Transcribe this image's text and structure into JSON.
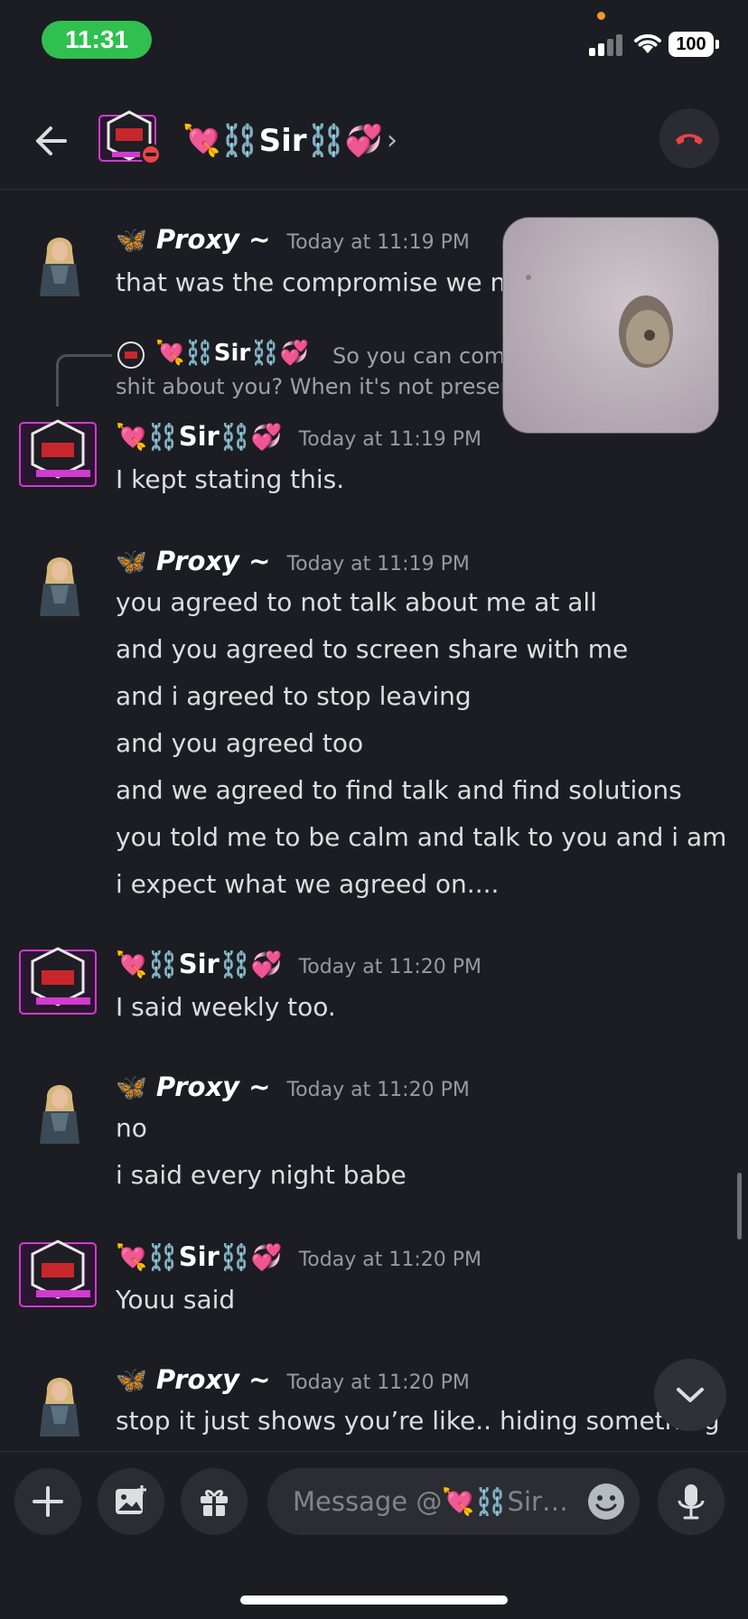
{
  "status_bar": {
    "time": "11:31",
    "battery": "100"
  },
  "header": {
    "title": "💘⛓️Sir⛓️💞",
    "chevron": "›"
  },
  "messages": [
    {
      "author": "Proxy ~",
      "badge": "🦋",
      "time": "Today at 11:19 PM",
      "lines": [
        "that was the compromise we ma"
      ]
    },
    {
      "author": "Sir",
      "badge_left": "💘⛓️",
      "badge_right": "⛓️💞",
      "time": "Today at 11:19 PM",
      "lines": [
        "I kept stating this."
      ]
    },
    {
      "author": "Proxy ~",
      "badge": "🦋",
      "time": "Today at 11:19 PM",
      "lines": [
        "you agreed to not talk about me at all",
        "and you agreed to screen share with me",
        "and i agreed to stop leaving",
        "and you agreed too",
        "and we agreed to find talk and find solutions",
        "you told me to be calm and talk to you and i am",
        "i expect what we agreed on...."
      ]
    },
    {
      "author": "Sir",
      "badge_left": "💘⛓️",
      "badge_right": "⛓️💞",
      "time": "Today at 11:20 PM",
      "lines": [
        "I said weekly too."
      ]
    },
    {
      "author": "Proxy ~",
      "badge": "🦋",
      "time": "Today at 11:20 PM",
      "lines": [
        "no",
        "i said every night babe"
      ]
    },
    {
      "author": "Sir",
      "badge_left": "💘⛓️",
      "badge_right": "⛓️💞",
      "time": "Today at 11:20 PM",
      "lines": [
        "Youu said"
      ]
    },
    {
      "author": "Proxy ~",
      "badge": "🦋",
      "time": "Today at 11:20 PM",
      "lines": [
        "stop it just shows you’re like.. hiding something"
      ]
    }
  ],
  "reply_reference": {
    "author": "💘⛓️Sir⛓️💞",
    "line1": "So you can com",
    "line2": "shit about you? When it's not presen"
  },
  "composer": {
    "placeholder": "Message @💘⛓️Sir…"
  },
  "colors": {
    "call_end": "#ed4245",
    "status_green": "#30c04f",
    "background": "#1c1d22"
  },
  "icons": [
    "back-arrow-icon",
    "end-call-icon",
    "plus-icon",
    "image-icon",
    "gift-icon",
    "emoji-icon",
    "microphone-icon",
    "chevron-down-icon"
  ]
}
